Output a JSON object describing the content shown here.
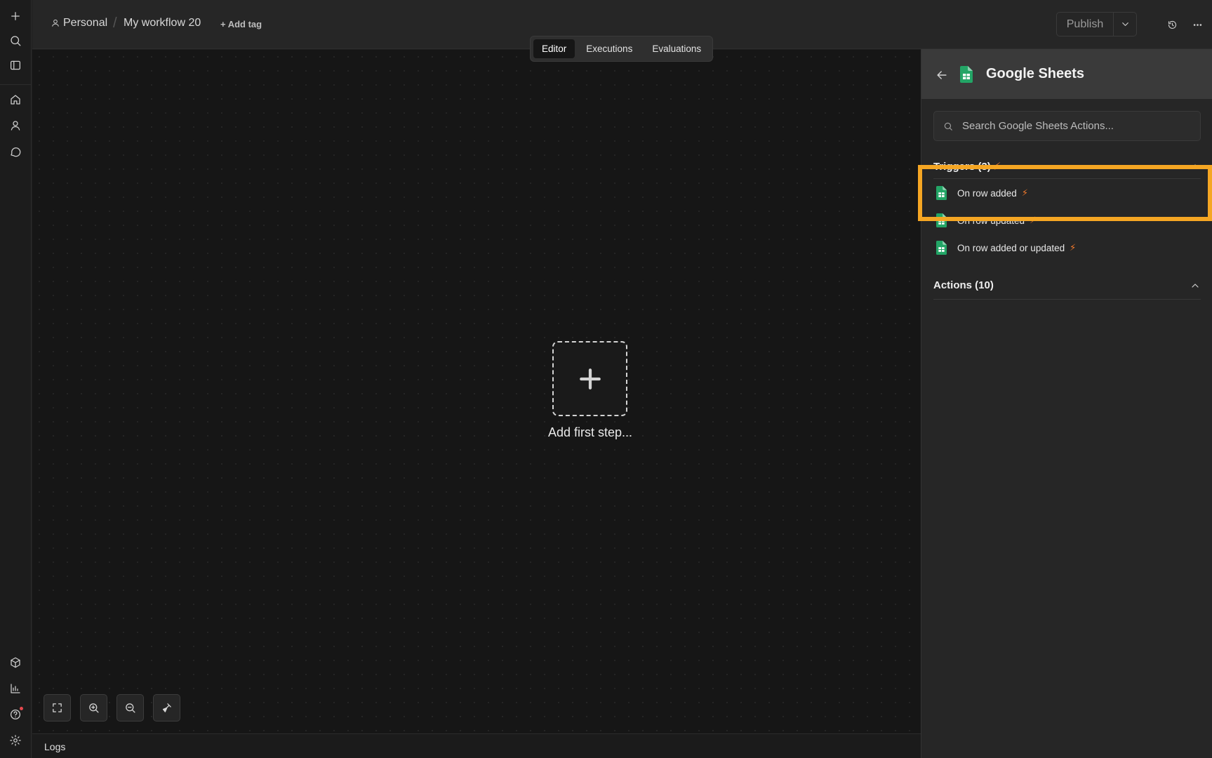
{
  "rail": {
    "top_icons": [
      "plus-icon",
      "search-icon",
      "sidebar-toggle-icon"
    ],
    "nav_icons": [
      "home-icon",
      "user-icon",
      "chat-icon"
    ],
    "bottom_icons": [
      "templates-icon",
      "insights-icon",
      "help-icon",
      "settings-icon"
    ]
  },
  "header": {
    "project": "Personal",
    "workflow_name": "My workflow 20",
    "add_tag": "+ Add tag",
    "publish_label": "Publish"
  },
  "tabs": [
    {
      "label": "Editor",
      "active": true
    },
    {
      "label": "Executions",
      "active": false
    },
    {
      "label": "Evaluations",
      "active": false
    }
  ],
  "canvas": {
    "add_first_step": "Add first step...",
    "logs_label": "Logs"
  },
  "panel": {
    "title": "Google Sheets",
    "search_placeholder": "Search Google Sheets Actions...",
    "triggers_heading": "Triggers (3)",
    "triggers": [
      {
        "label": "On row added",
        "bolt": "⚡"
      },
      {
        "label": "On row updated",
        "bolt": "⚡"
      },
      {
        "label": "On row added or updated",
        "bolt": "⚡"
      }
    ],
    "actions_heading": "Actions (10)"
  },
  "colors": {
    "highlight": "#f5a623",
    "sheets_green": "#23a566",
    "bolt_orange": "#f2792b"
  }
}
